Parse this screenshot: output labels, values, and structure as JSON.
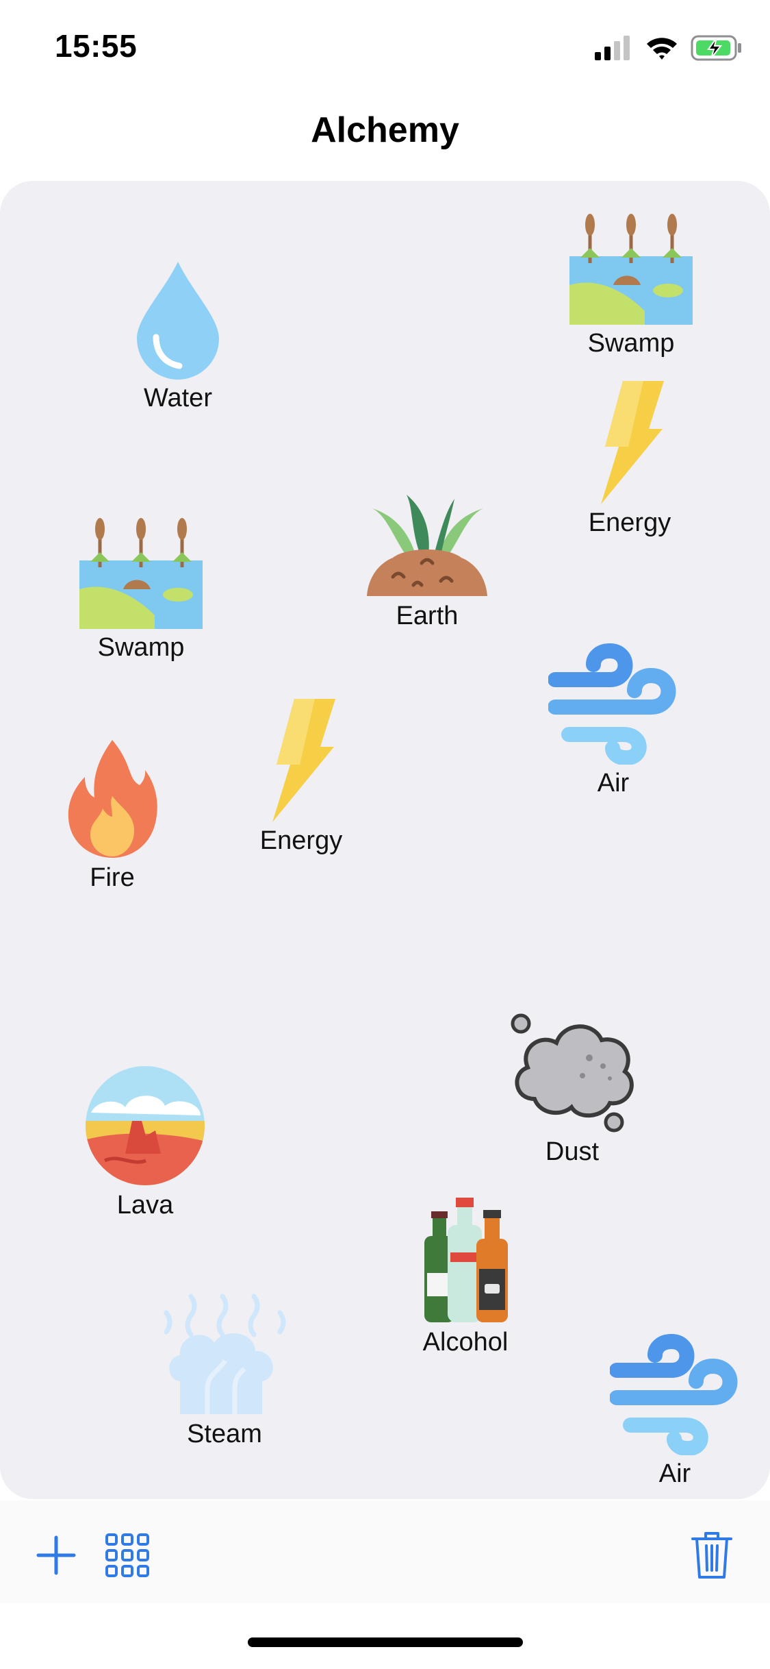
{
  "status": {
    "time": "15:55"
  },
  "nav": {
    "title": "Alchemy"
  },
  "board": {
    "elements": [
      {
        "label": "Water",
        "icon": "water-drop-icon"
      },
      {
        "label": "Swamp",
        "icon": "swamp-icon"
      },
      {
        "label": "Energy",
        "icon": "lightning-icon"
      },
      {
        "label": "Swamp",
        "icon": "swamp-icon"
      },
      {
        "label": "Earth",
        "icon": "earth-icon"
      },
      {
        "label": "Air",
        "icon": "wind-icon"
      },
      {
        "label": "Energy",
        "icon": "lightning-icon"
      },
      {
        "label": "Fire",
        "icon": "fire-icon"
      },
      {
        "label": "Dust",
        "icon": "dust-cloud-icon"
      },
      {
        "label": "Lava",
        "icon": "lava-icon"
      },
      {
        "label": "Alcohol",
        "icon": "bottles-icon"
      },
      {
        "label": "Steam",
        "icon": "steam-icon"
      },
      {
        "label": "Air",
        "icon": "wind-icon"
      }
    ]
  },
  "toolbar": {
    "add_icon": "plus-icon",
    "grid_icon": "grid-icon",
    "trash_icon": "trash-icon"
  },
  "colors": {
    "accent": "#2f7ae5",
    "board": "#efeff4"
  }
}
